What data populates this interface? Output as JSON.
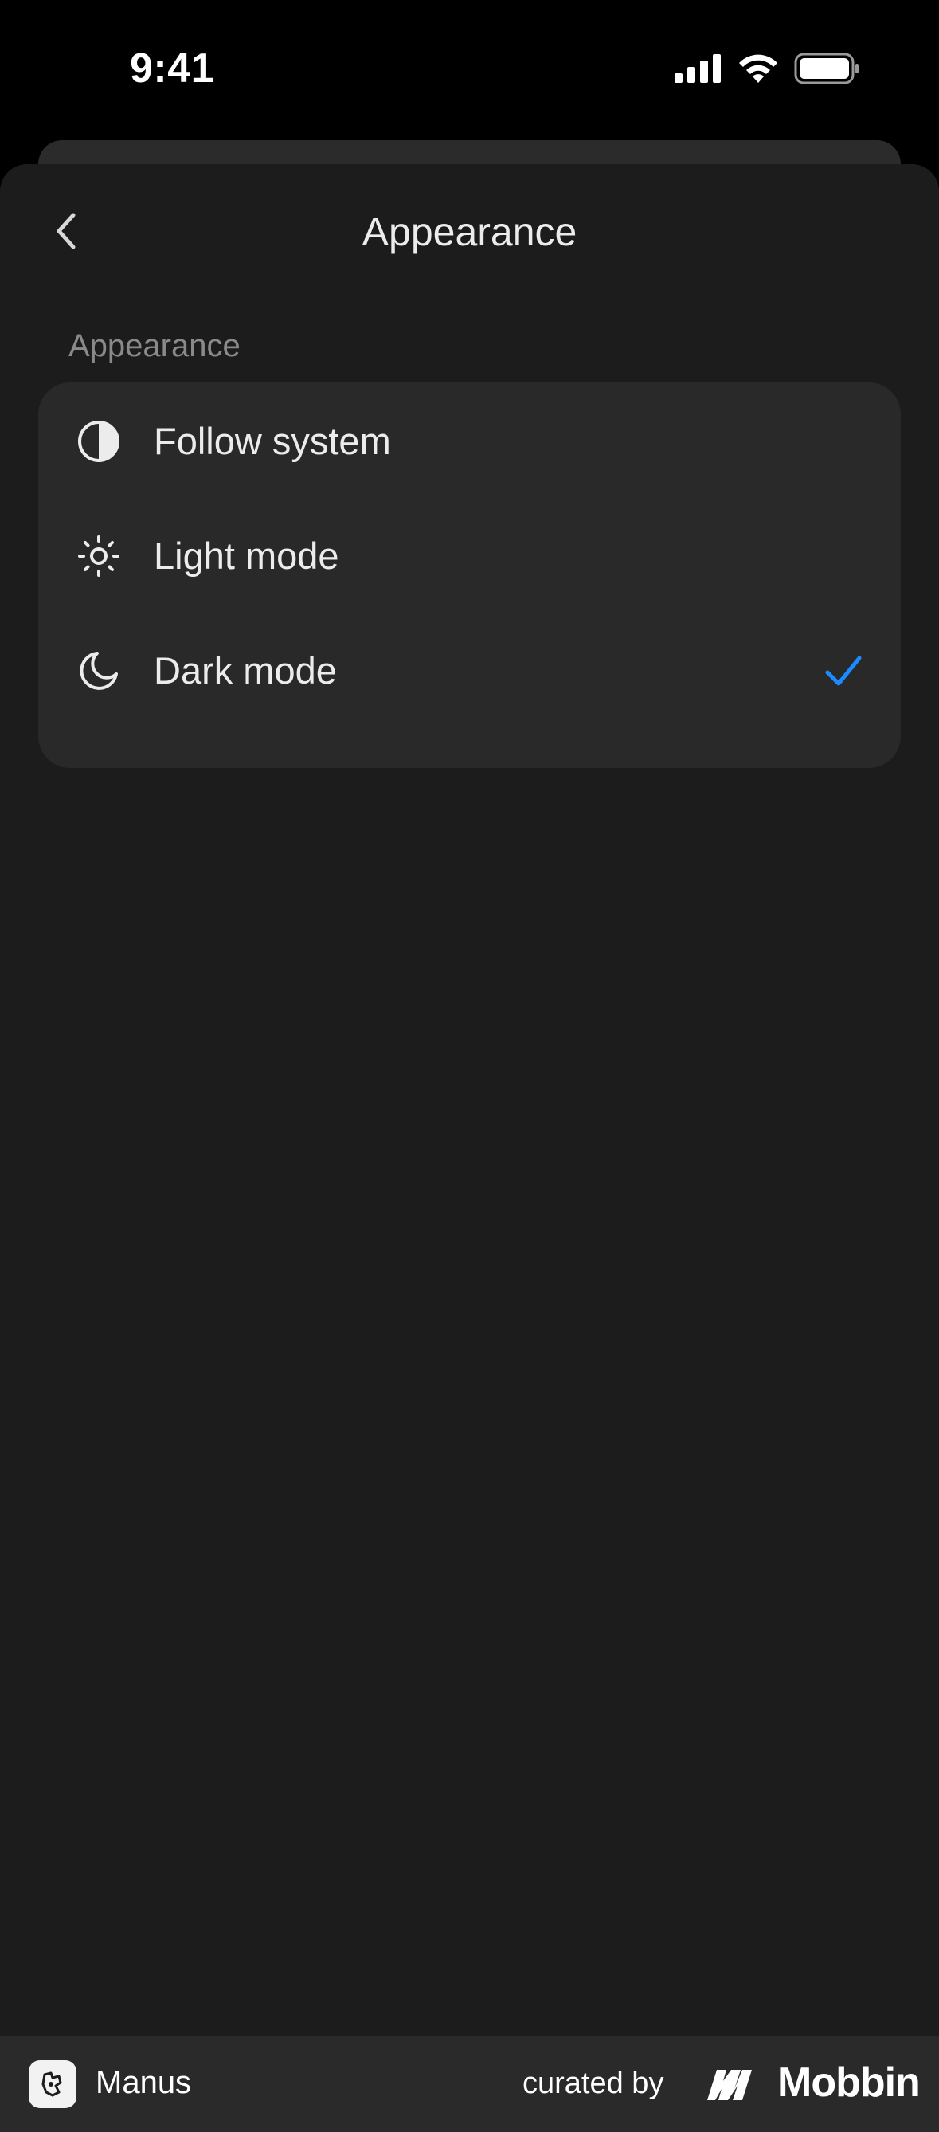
{
  "status_bar": {
    "time": "9:41"
  },
  "header": {
    "title": "Appearance",
    "back_icon": "chevron-left-icon"
  },
  "section": {
    "label": "Appearance"
  },
  "options": [
    {
      "label": "Follow system",
      "icon": "half-circle-icon",
      "selected": false
    },
    {
      "label": "Light mode",
      "icon": "sun-icon",
      "selected": false
    },
    {
      "label": "Dark mode",
      "icon": "moon-icon",
      "selected": true
    }
  ],
  "footer": {
    "app_name": "Manus",
    "curated_by": "curated by",
    "brand": "Mobbin"
  },
  "colors": {
    "background": "#1c1c1c",
    "card": "#292929",
    "accent_check": "#1a8cff",
    "text_primary": "#ececec",
    "text_secondary": "#8a8a8a"
  }
}
